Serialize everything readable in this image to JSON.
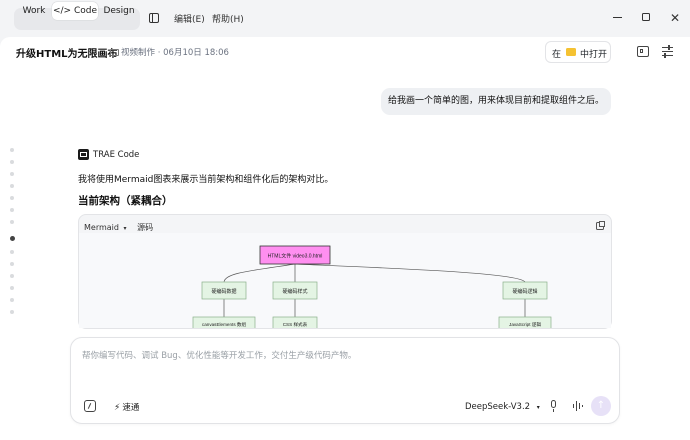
{
  "titlebar": {
    "modes": [
      "Work",
      "Code",
      "Design"
    ],
    "active_mode": "Code",
    "code_glyph": "</>",
    "menu_edit": "编辑(E)",
    "menu_help": "帮助(H)"
  },
  "header": {
    "title": "升级HTML为无限画布",
    "folder": "视频制作",
    "timestamp": "06月10日 18:06",
    "open_prefix": "在",
    "open_suffix": "中打开"
  },
  "chat": {
    "user_message": "给我画一个简单的图，用来体现目前和提取组件之后。",
    "assistant_name": "TRAE Code",
    "assistant_text": "我将使用Mermaid图表来展示当前架构和组件化后的架构对比。",
    "section_heading": "当前架构（紧耦合）",
    "code_block": {
      "language": "Mermaid",
      "source_tab": "源码"
    },
    "diagram": {
      "root": "HTML文件 video3.0.html",
      "nodes": [
        "硬编码数据",
        "硬编码样式",
        "硬编码逻辑"
      ],
      "children": [
        "canvasElements 数组",
        "CSS 样式表",
        "JavaScript 逻辑"
      ]
    }
  },
  "composer": {
    "placeholder": "帮你编写代码、调试 Bug、优化性能等开发工作，交付生产级代码产物。",
    "fast_label": "速通",
    "model": "DeepSeek-V3.2"
  },
  "colors": {
    "accent": "#9b7be8",
    "root_fill": "#ff8ff0",
    "node_fill": "#e4f4e4"
  }
}
